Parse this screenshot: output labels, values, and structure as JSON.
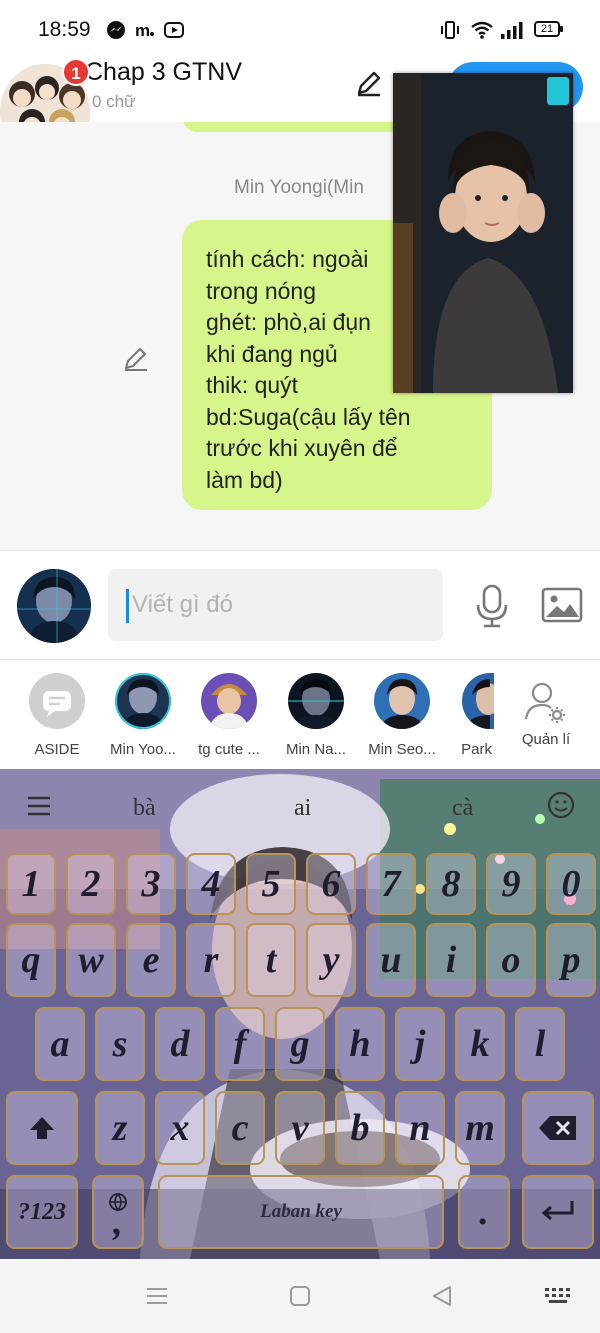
{
  "status_bar": {
    "time": "18:59",
    "icons": [
      "messenger-icon",
      "m-app-icon",
      "youtube-icon",
      "vibrate-icon",
      "wifi-icon",
      "signal-icon"
    ],
    "battery": "21"
  },
  "header": {
    "title": "Chap 3 GTNV",
    "subtitle": "0 chữ",
    "notification_count": "1",
    "accent_color": "#2196f3"
  },
  "chat": {
    "sender_name": "Min Yoongi(Min",
    "message_lines": [
      "tính cách: ngoài",
      "trong nóng",
      "ghét: phò,ai đụn",
      "khi đang ngủ",
      "thik: quýt",
      "bd:Suga(cậu lấy tên",
      "trước khi xuyên để",
      "làm bd)"
    ],
    "bubble_color": "#d6f58a"
  },
  "composer": {
    "placeholder": "Viết gì đó"
  },
  "characters": [
    {
      "name": "ASIDE"
    },
    {
      "name": "Min Yoo..."
    },
    {
      "name": "tg cute ..."
    },
    {
      "name": "Min Na..."
    },
    {
      "name": "Min Seo..."
    },
    {
      "name": "Park "
    },
    {
      "name": "Quản lí"
    }
  ],
  "keyboard": {
    "suggestions": [
      "bà",
      "ai",
      "cà"
    ],
    "number_row": [
      "1",
      "2",
      "3",
      "4",
      "5",
      "6",
      "7",
      "8",
      "9",
      "0"
    ],
    "row1": [
      "q",
      "w",
      "e",
      "r",
      "t",
      "y",
      "u",
      "i",
      "o",
      "p"
    ],
    "row2": [
      "a",
      "s",
      "d",
      "f",
      "g",
      "h",
      "j",
      "k",
      "l"
    ],
    "row3": [
      "z",
      "x",
      "c",
      "v",
      "b",
      "n",
      "m"
    ],
    "symbols_key": "?123",
    "comma_key": ",",
    "space_label": "Laban key",
    "period_key": ".",
    "key_border_color": "#b79358"
  },
  "nav_bar": {
    "icons": [
      "menu-icon",
      "home-icon",
      "back-icon",
      "keyboard-icon"
    ]
  }
}
